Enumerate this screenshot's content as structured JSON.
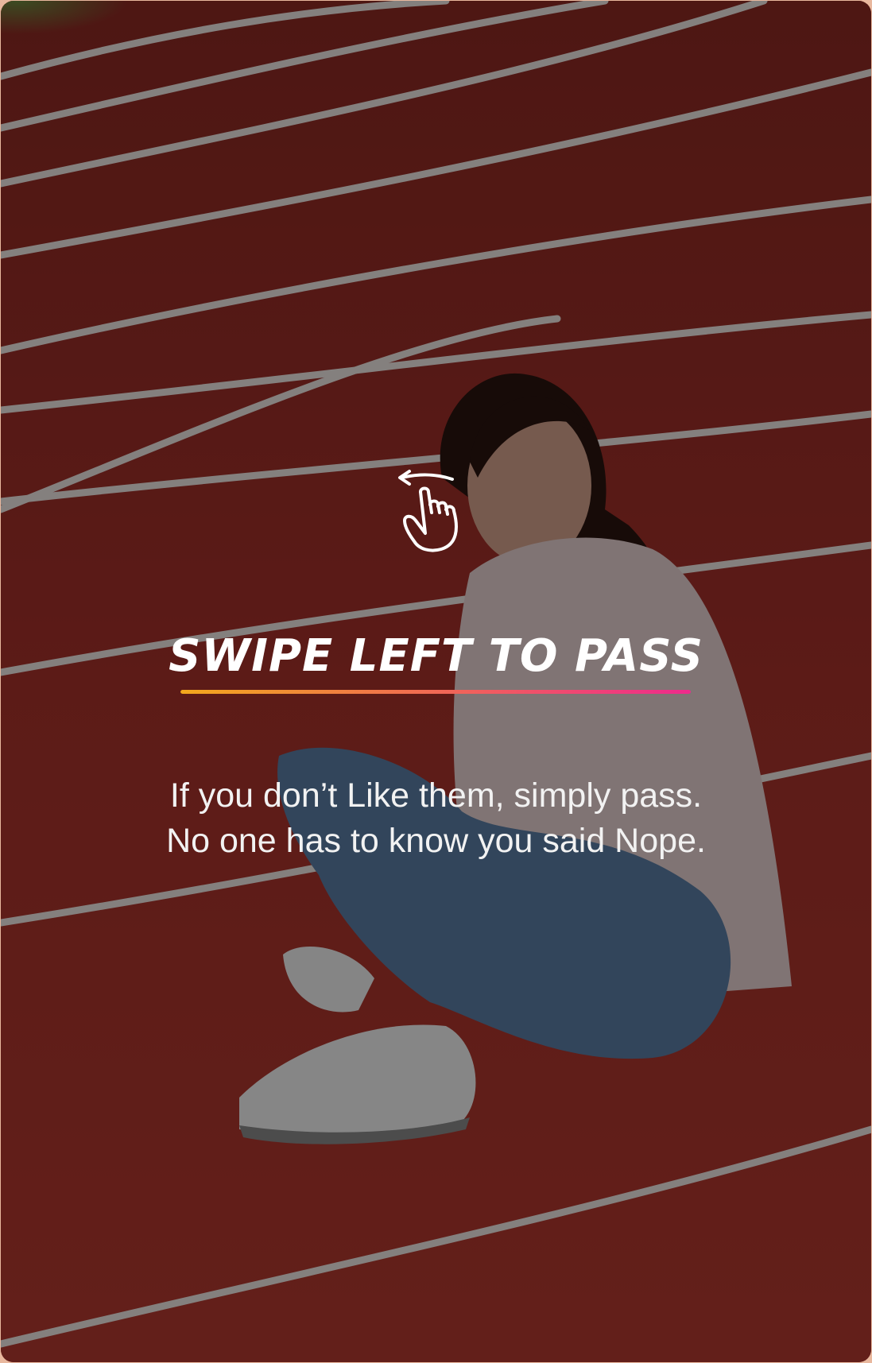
{
  "onboarding": {
    "heading": "SWIPE LEFT TO PASS",
    "description": "If you don’t Like them, simply pass. No one has to know you said Nope.",
    "gesture_icon": "swipe-left-hand-icon"
  },
  "colors": {
    "underline_gradient_start": "#f2a81d",
    "underline_gradient_end": "#ee2a8c",
    "track": "#a8322b",
    "text": "#ffffff"
  }
}
